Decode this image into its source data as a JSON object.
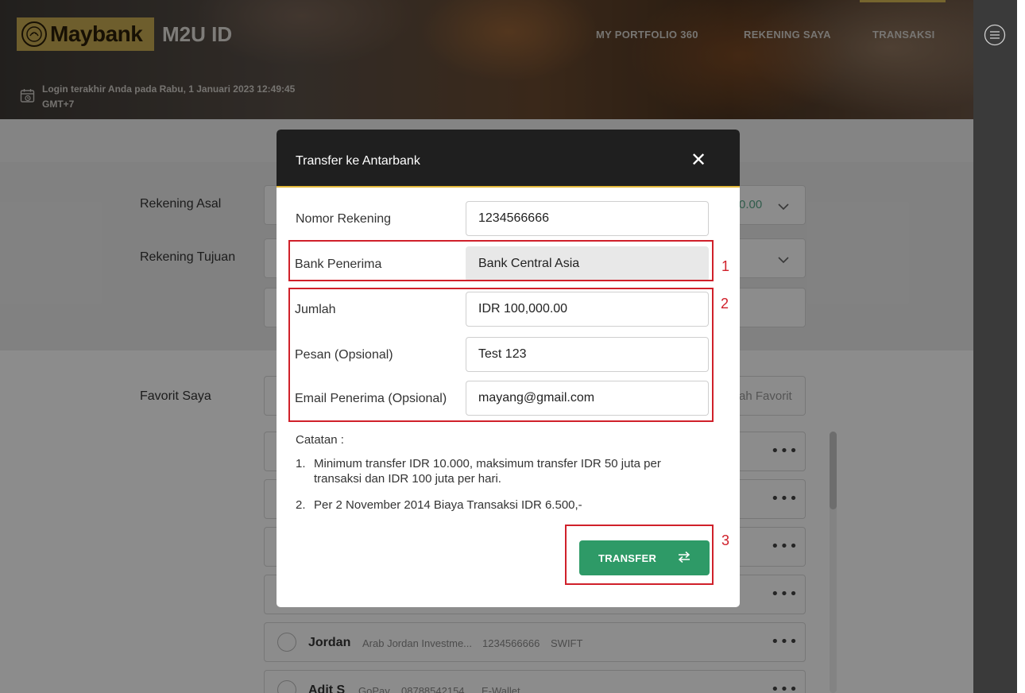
{
  "header": {
    "logo_text": "Maybank",
    "app_name": "M2U ID",
    "nav": [
      "MY PORTFOLIO 360",
      "REKENING SAYA",
      "TRANSAKSI"
    ],
    "last_login_line1": "Login terakhir Anda pada Rabu, 1 Januari 2023 12:49:45",
    "last_login_line2": "GMT+7"
  },
  "background": {
    "rekening_asal_label": "Rekening Asal",
    "rekening_asal_value_fragment": "0.00",
    "rekening_tujuan_label": "Rekening Tujuan",
    "favorit_label": "Favorit Saya",
    "favorit_action_fragment": "ah Favorit",
    "rows": [
      {
        "name": "Jordan",
        "bank": "Arab Jordan Investme...",
        "account": "1234566666",
        "type": "SWIFT"
      },
      {
        "name": "Adit S",
        "bank": "GoPay",
        "account": "08788542154",
        "type": "E-Wallet"
      }
    ],
    "more_glyph": "•••"
  },
  "modal": {
    "title": "Transfer ke Antarbank",
    "close_glyph": "✕",
    "fields": [
      {
        "label": "Nomor Rekening",
        "value": "1234566666"
      },
      {
        "label": "Bank Penerima",
        "value": "Bank Central Asia"
      },
      {
        "label": "Jumlah",
        "value": "IDR 100,000.00"
      },
      {
        "label": "Pesan (Opsional)",
        "value": "Test 123"
      },
      {
        "label": "Email Penerima (Opsional)",
        "value": "mayang@gmail.com"
      }
    ],
    "notes_title": "Catatan :",
    "notes": [
      {
        "num": "1.",
        "text": "Minimum transfer IDR 10.000, maksimum transfer IDR 50 juta per transaksi dan IDR 100 juta per hari."
      },
      {
        "num": "2.",
        "text": "Per 2 November 2014 Biaya Transaksi IDR 6.500,-"
      }
    ],
    "transfer_label": "TRANSFER"
  },
  "annotations": [
    "1",
    "2",
    "3"
  ],
  "colors": {
    "accent_gold": "#c9ab52",
    "button_green": "#2e9a67",
    "annotation_red": "#d0202a",
    "modal_header": "#1f1f1f"
  },
  "icons": [
    "maybank-tiger-icon",
    "calendar-clock-icon",
    "hamburger-menu-icon",
    "close-icon",
    "transfer-arrows-icon",
    "chevron-down-icon",
    "more-dots-icon"
  ]
}
